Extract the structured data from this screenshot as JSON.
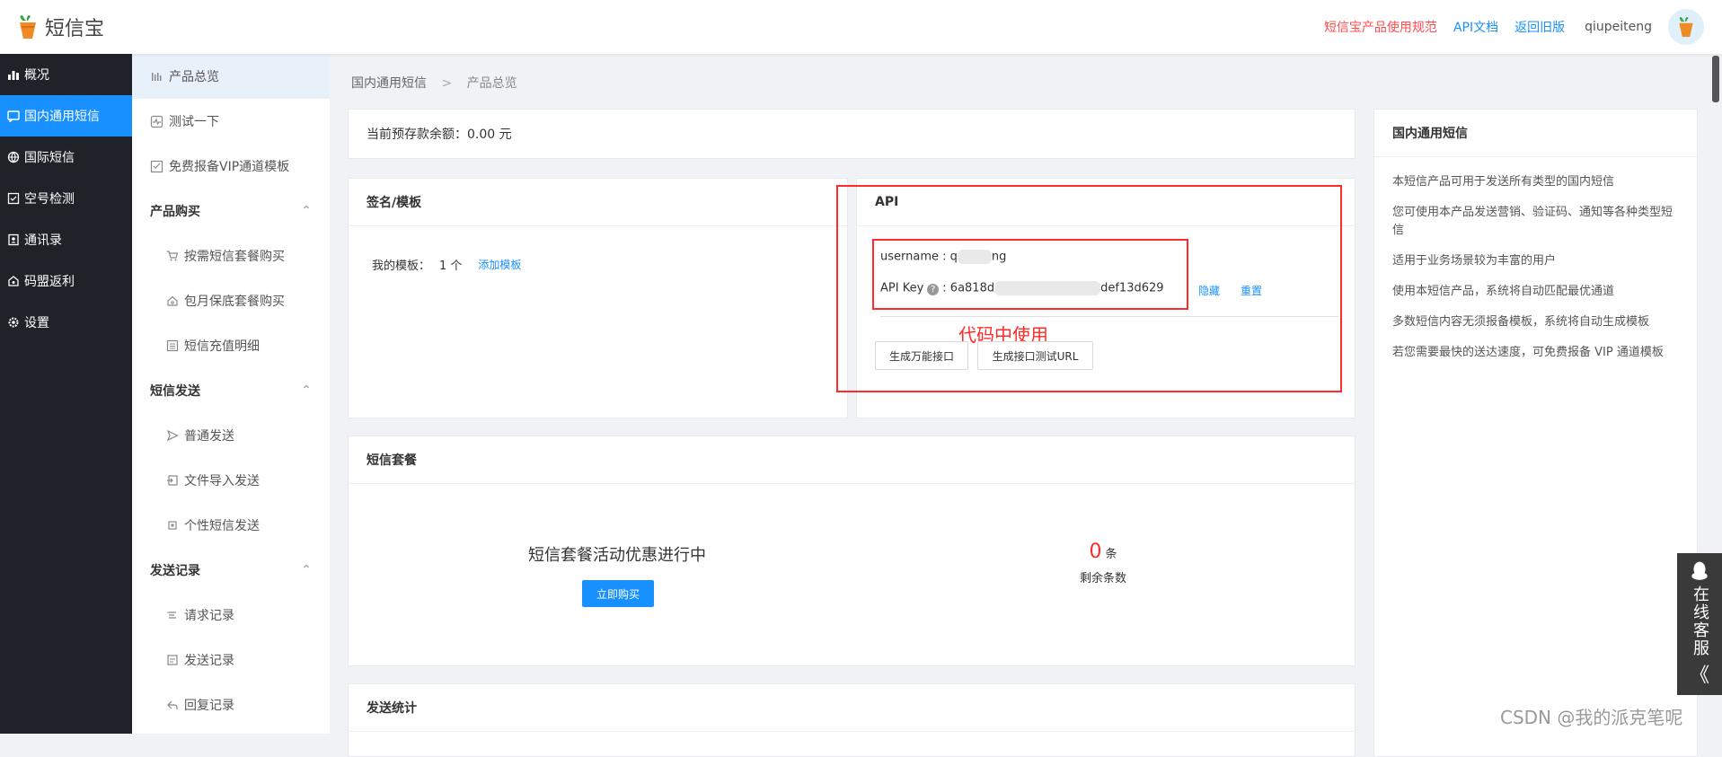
{
  "brand": {
    "name": "短信宝"
  },
  "topnav": {
    "rules": "短信宝产品使用规范",
    "api_doc": "API文档",
    "old": "返回旧版",
    "username": "qiupeiteng"
  },
  "sidebar1": [
    "概况",
    "国内通用短信",
    "国际短信",
    "空号检测",
    "通讯录",
    "码盟返利",
    "设置"
  ],
  "sidebar2": {
    "overview": "产品总览",
    "test": "测试一下",
    "vip": "免费报备VIP通道模板",
    "purchase": {
      "title": "产品购买",
      "items": [
        "按需短信套餐购买",
        "包月保底套餐购买",
        "短信充值明细"
      ]
    },
    "send": {
      "title": "短信发送",
      "items": [
        "普通发送",
        "文件导入发送",
        "个性短信发送"
      ]
    },
    "records": {
      "title": "发送记录",
      "items": [
        "请求记录",
        "发送记录",
        "回复记录"
      ]
    }
  },
  "breadcrumb": {
    "root": "国内通用短信",
    "sep": ">",
    "current": "产品总览"
  },
  "balance": {
    "text": "当前预存款余额：0.00 元"
  },
  "signature": {
    "title": "签名/模板",
    "label": "我的模板：",
    "count": "1 个",
    "add": "添加模板"
  },
  "api": {
    "title": "API",
    "username_label": "username : ",
    "username_prefix": "q",
    "username_suffix": "ng",
    "key_label": "API Key",
    "key_prefix": ": 6a818d",
    "key_suffix": "def13d629",
    "hide": "隐藏",
    "reset": "重置",
    "btn_universal": "生成万能接口",
    "btn_test": "生成接口测试URL",
    "annotation": "代码中使用"
  },
  "package": {
    "title": "短信套餐",
    "promo": "短信套餐活动优惠进行中",
    "buy": "立即购买",
    "remaining_count": "0",
    "remaining_unit": "条",
    "remaining_label": "剩余条数"
  },
  "stats": {
    "title": "发送统计"
  },
  "info": {
    "title": "国内通用短信",
    "items": [
      "本短信产品可用于发送所有类型的国内短信",
      "您可使用本产品发送营销、验证码、通知等各种类型短信",
      "适用于业务场景较为丰富的用户",
      "使用本短信产品，系统将自动匹配最优通道",
      "多数短信内容无须报备模板，系统将自动生成模板",
      "若您需要最快的送达速度，可免费报备 VIP 通道模板"
    ]
  },
  "service": {
    "label": "在线客服",
    "collapse": "《"
  },
  "watermark": "CSDN @我的派克笔呢",
  "colors": {
    "primary": "#1890ff",
    "danger": "#ff2a2a",
    "sidebar": "#1f2228"
  }
}
